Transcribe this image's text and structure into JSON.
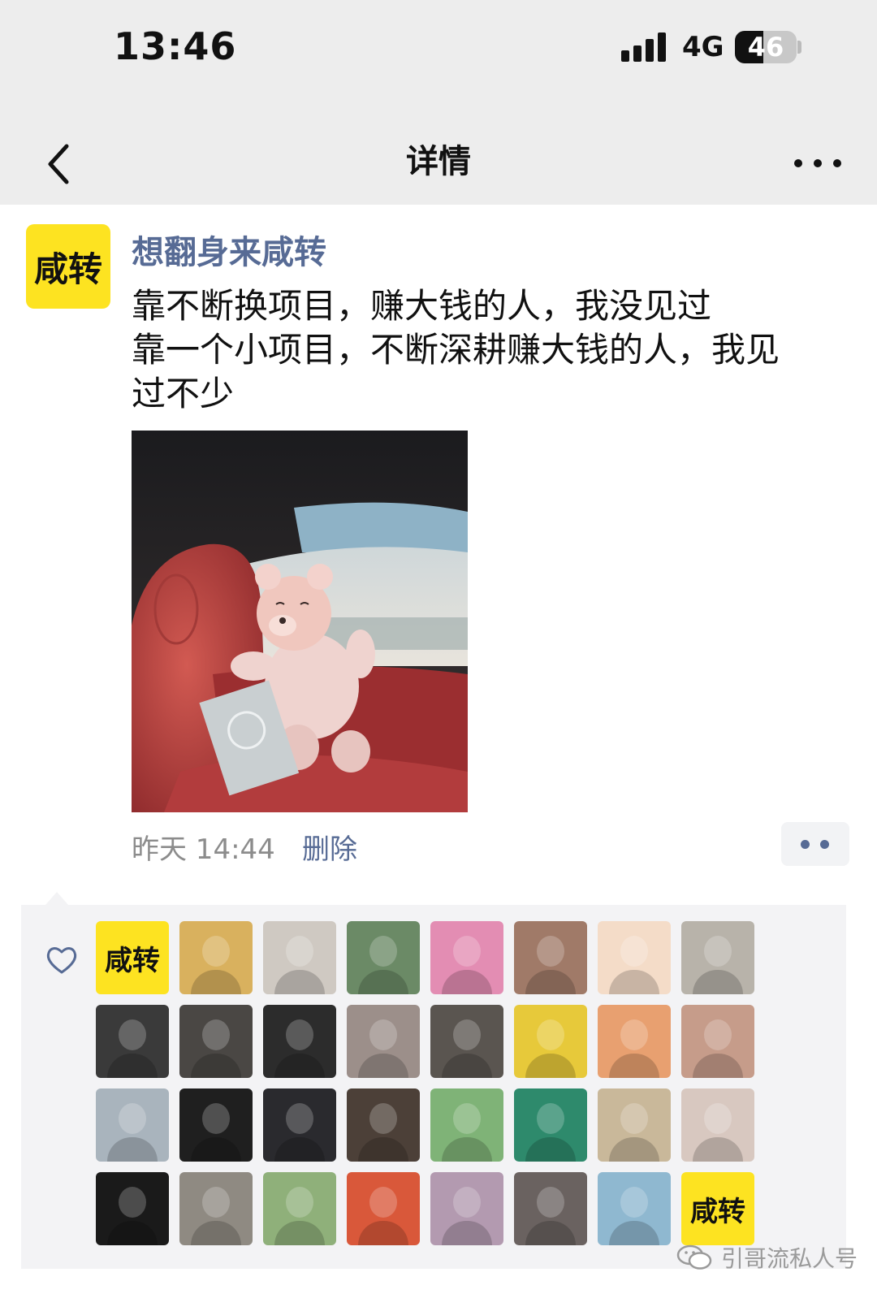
{
  "status_bar": {
    "time": "13:46",
    "network": "4G",
    "battery": "46",
    "battery_level_percent": 46
  },
  "nav": {
    "title": "详情"
  },
  "post": {
    "avatar_text": "咸转",
    "username": "想翻身来咸转",
    "text_lines": [
      "靠不断换项目，赚大钱的人，我没见过",
      "靠一个小项目，不断深耕赚大钱的人，我见",
      "过不少"
    ],
    "time": "昨天 14:44",
    "delete_label": "删除"
  },
  "likes": {
    "avatars": [
      {
        "kind": "text",
        "text": "咸转",
        "color": "#fde321"
      },
      {
        "kind": "photo",
        "color": "#d9b15e"
      },
      {
        "kind": "photo",
        "color": "#cfc9c2"
      },
      {
        "kind": "photo",
        "color": "#6b8a66"
      },
      {
        "kind": "photo",
        "color": "#e38db3"
      },
      {
        "kind": "photo",
        "color": "#a07a68"
      },
      {
        "kind": "photo",
        "color": "#f4dcc8"
      },
      {
        "kind": "photo",
        "color": "#b8b3aa"
      },
      {
        "kind": "photo",
        "color": "#3a3a3a"
      },
      {
        "kind": "photo",
        "color": "#4a4744"
      },
      {
        "kind": "photo",
        "color": "#2c2c2c"
      },
      {
        "kind": "photo",
        "color": "#9c8f8a"
      },
      {
        "kind": "photo",
        "color": "#5a5550"
      },
      {
        "kind": "photo",
        "color": "#e7c93a"
      },
      {
        "kind": "photo",
        "color": "#e8a070"
      },
      {
        "kind": "photo",
        "color": "#c69c8a"
      },
      {
        "kind": "photo",
        "color": "#a9b4bd"
      },
      {
        "kind": "photo",
        "color": "#1f1f1f"
      },
      {
        "kind": "photo",
        "color": "#2a2a2e"
      },
      {
        "kind": "photo",
        "color": "#4c4038"
      },
      {
        "kind": "photo",
        "color": "#7fb377"
      },
      {
        "kind": "photo",
        "color": "#2e8a6c"
      },
      {
        "kind": "photo",
        "color": "#c9b89a"
      },
      {
        "kind": "photo",
        "color": "#d8c8c0"
      },
      {
        "kind": "photo",
        "color": "#1a1a1a"
      },
      {
        "kind": "photo",
        "color": "#8f8a82"
      },
      {
        "kind": "photo",
        "color": "#8fb07a"
      },
      {
        "kind": "photo",
        "color": "#d9583a"
      },
      {
        "kind": "photo",
        "color": "#b39ab0"
      },
      {
        "kind": "photo",
        "color": "#6a6260"
      },
      {
        "kind": "photo",
        "color": "#8fb8d0"
      },
      {
        "kind": "text",
        "text": "咸转",
        "color": "#fde321"
      }
    ]
  },
  "watermark": {
    "text": "引哥流私人号"
  }
}
